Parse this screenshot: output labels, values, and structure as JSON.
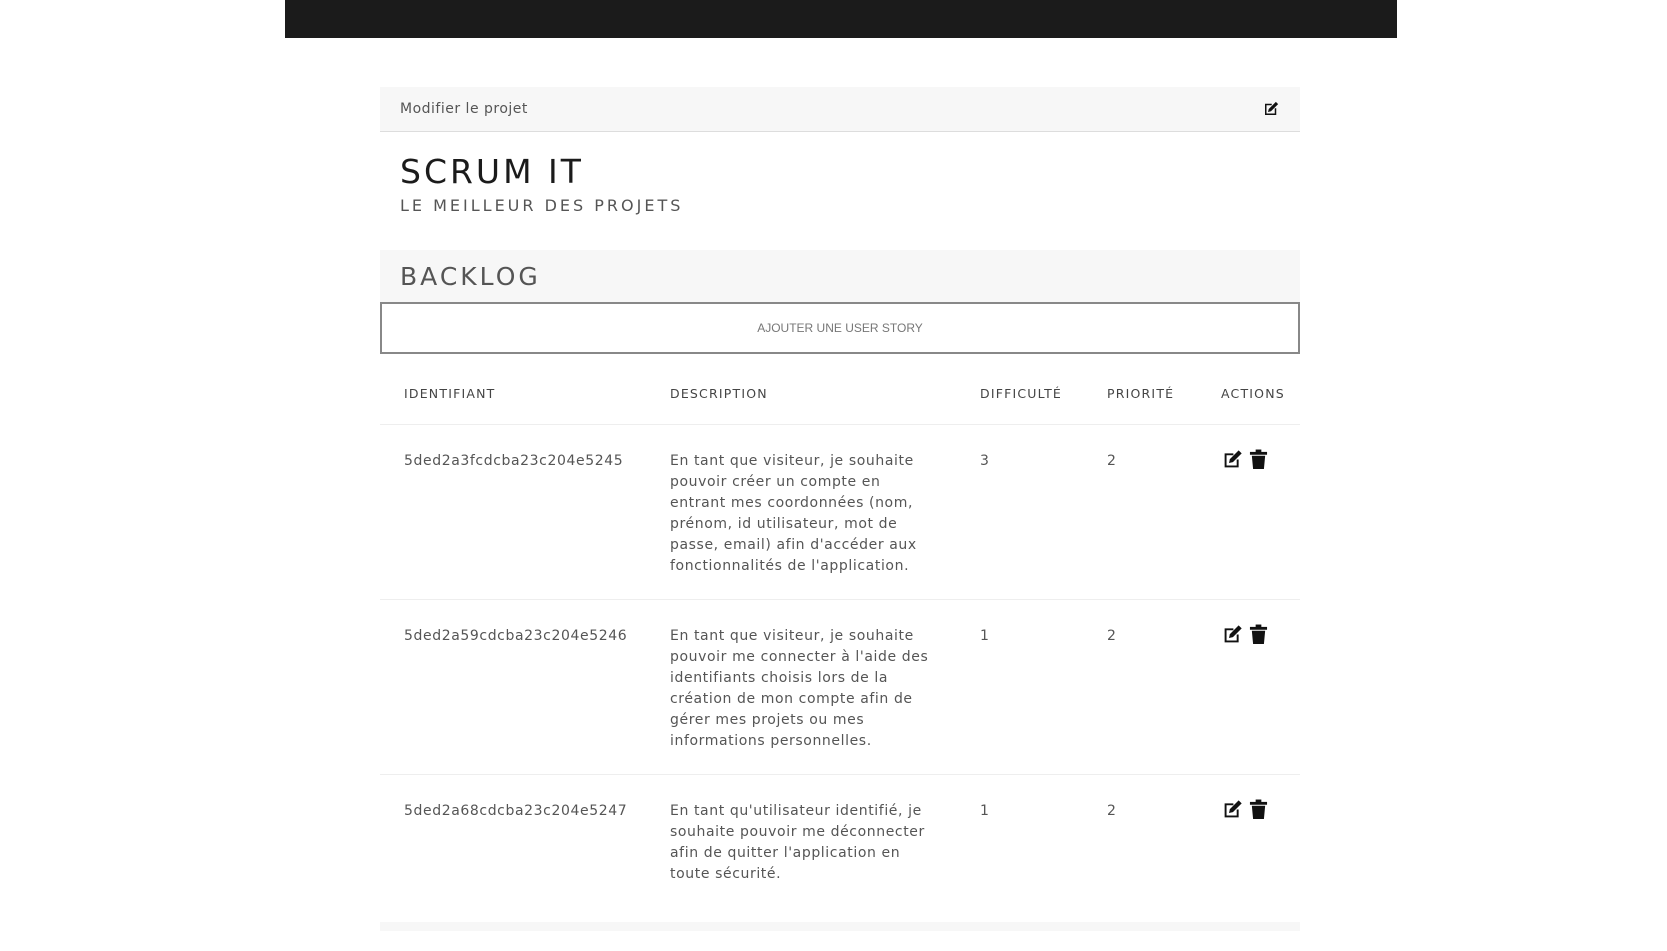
{
  "header": {
    "edit_project_label": "Modifier le projet"
  },
  "project": {
    "title": "SCRUM IT",
    "subtitle": "LE MEILLEUR DES PROJETS"
  },
  "backlog": {
    "title": "BACKLOG",
    "add_button_label": "AJOUTER UNE USER STORY",
    "columns": {
      "id": "IDENTIFIANT",
      "description": "DESCRIPTION",
      "difficulty": "DIFFICULTÉ",
      "priority": "PRIORITÉ",
      "actions": "ACTIONS"
    },
    "stories": [
      {
        "id": "5ded2a3fcdcba23c204e5245",
        "description": "En tant que visiteur, je souhaite pouvoir créer un compte en entrant mes coordonnées (nom, prénom, id utilisateur, mot de passe, email) afin d'accéder aux fonctionnalités de l'application.",
        "difficulty": "3",
        "priority": "2"
      },
      {
        "id": "5ded2a59cdcba23c204e5246",
        "description": "En tant que visiteur, je souhaite pouvoir me connecter à l'aide des identifiants choisis lors de la création de mon compte afin de gérer mes projets ou mes informations personnelles.",
        "difficulty": "1",
        "priority": "2"
      },
      {
        "id": "5ded2a68cdcba23c204e5247",
        "description": "En tant qu'utilisateur identifié, je souhaite pouvoir me déconnecter afin de quitter l'application en toute sécurité.",
        "difficulty": "1",
        "priority": "2"
      }
    ]
  },
  "icons": {
    "edit": "edit-icon",
    "delete": "trash-icon"
  },
  "colors": {
    "topbar": "#1b1b1b",
    "panel": "#f7f7f7",
    "text": "#555555"
  }
}
